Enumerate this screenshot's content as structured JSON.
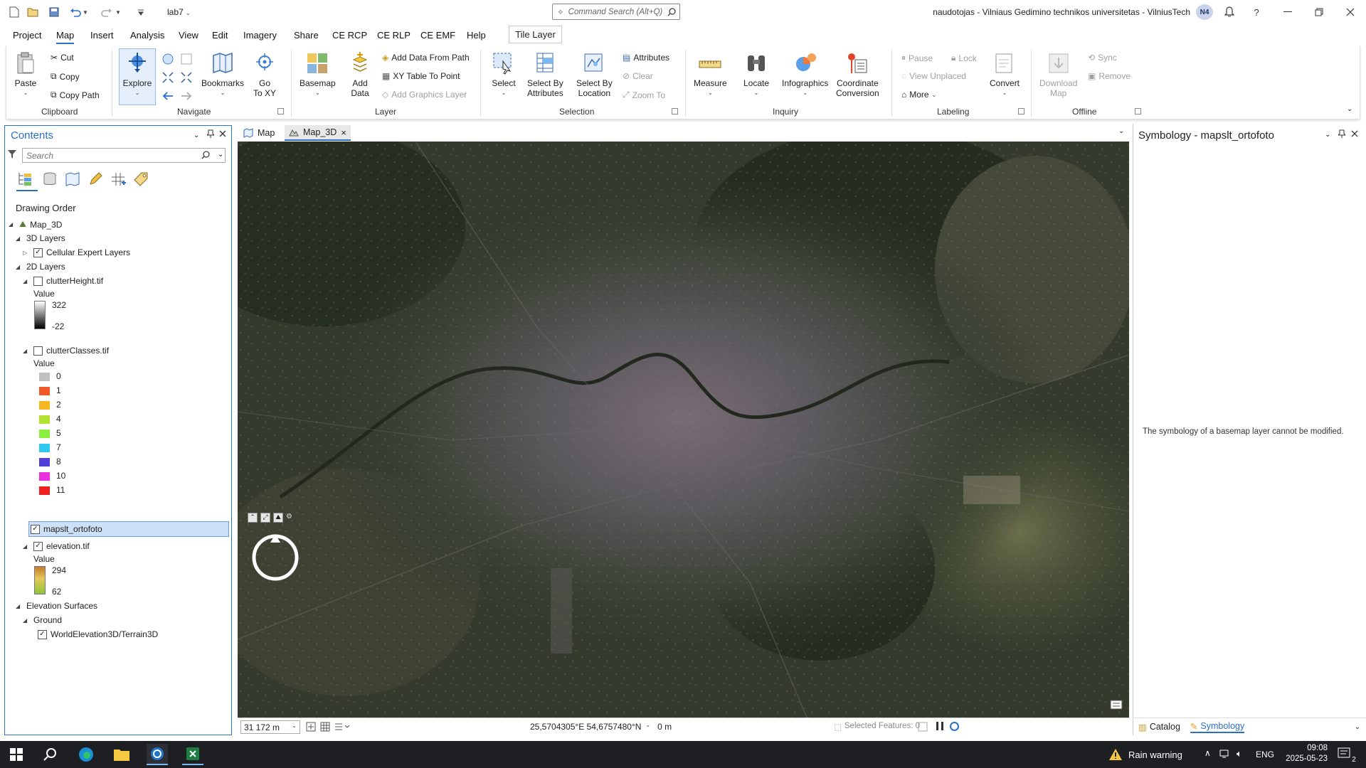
{
  "titlebar": {
    "project_name": "lab7",
    "command_search_placeholder": "Command Search (Alt+Q)",
    "user_org": "naudotojas - Vilniaus Gedimino technikos universitetas - VilniusTech",
    "avatar_initials": "N4",
    "help": "?"
  },
  "menu": {
    "items": [
      "Project",
      "Map",
      "Insert",
      "Analysis",
      "View",
      "Edit",
      "Imagery",
      "Share",
      "CE RCP",
      "CE RLP",
      "CE EMF",
      "Help"
    ],
    "active": "Map",
    "contextual_tab": "Tile Layer"
  },
  "ribbon": {
    "clipboard": {
      "paste": "Paste",
      "cut": "Cut",
      "copy": "Copy",
      "copy_path": "Copy Path",
      "group": "Clipboard"
    },
    "navigate": {
      "explore": "Explore",
      "bookmarks": "Bookmarks",
      "goto_xy_1": "Go",
      "goto_xy_2": "To XY",
      "group": "Navigate"
    },
    "layer": {
      "basemap": "Basemap",
      "add_data_1": "Add",
      "add_data_2": "Data",
      "add_data_from_path": "Add Data From Path",
      "xy_table_to_point": "XY Table To Point",
      "add_graphics_layer": "Add Graphics Layer",
      "group": "Layer"
    },
    "selection": {
      "select": "Select",
      "select_by_attributes_1": "Select By",
      "select_by_attributes_2": "Attributes",
      "select_by_location_1": "Select By",
      "select_by_location_2": "Location",
      "attributes": "Attributes",
      "clear": "Clear",
      "zoom_to": "Zoom To",
      "group": "Selection"
    },
    "inquiry": {
      "measure": "Measure",
      "locate": "Locate",
      "infographics": "Infographics",
      "coordinate_conversion_1": "Coordinate",
      "coordinate_conversion_2": "Conversion",
      "group": "Inquiry"
    },
    "labeling": {
      "pause": "Pause",
      "lock": "Lock",
      "view_unplaced": "View Unplaced",
      "more": "More",
      "convert": "Convert",
      "group": "Labeling"
    },
    "offline": {
      "download_map_1": "Download",
      "download_map_2": "Map",
      "sync": "Sync",
      "remove": "Remove",
      "group": "Offline"
    }
  },
  "contents": {
    "title": "Contents",
    "search_placeholder": "Search",
    "drawing_order": "Drawing Order",
    "map_name": "Map_3D",
    "layers_3d": "3D Layers",
    "cellular": "Cellular Expert Layers",
    "layers_2d": "2D Layers",
    "clutter_height": "clutterHeight.tif",
    "value_label": "Value",
    "ch_max": "322",
    "ch_min": "-22",
    "clutter_classes": "clutterClasses.tif",
    "classes": [
      {
        "label": "0",
        "color": "#c0c0c0"
      },
      {
        "label": "1",
        "color": "#f05a28"
      },
      {
        "label": "2",
        "color": "#f5b820"
      },
      {
        "label": "4",
        "color": "#b4e030"
      },
      {
        "label": "5",
        "color": "#8af040"
      },
      {
        "label": "7",
        "color": "#30c8f0"
      },
      {
        "label": "8",
        "color": "#5040d8"
      },
      {
        "label": "10",
        "color": "#e830e0"
      },
      {
        "label": "11",
        "color": "#f02020"
      }
    ],
    "ortofoto": "mapslt_ortofoto",
    "elevation": "elevation.tif",
    "el_max": "294",
    "el_min": "62",
    "elevation_surfaces": "Elevation Surfaces",
    "ground": "Ground",
    "world_elevation": "WorldElevation3D/Terrain3D"
  },
  "map_tabs": [
    "Map",
    "Map_3D"
  ],
  "map_status": {
    "scale": "31 172 m",
    "coords": "25,5704305°E 54,6757480°N",
    "elevation": "0 m",
    "selected_features": "Selected Features: 0"
  },
  "symbology": {
    "title": "Symbology - mapslt_ortofoto",
    "message": "The symbology of a basemap layer cannot be modified.",
    "tab_catalog": "Catalog",
    "tab_symbology": "Symbology"
  },
  "taskbar": {
    "weather": "Rain warning",
    "lang": "ENG",
    "time": "09:08",
    "date": "2025-05-23",
    "notif_count": "2"
  }
}
